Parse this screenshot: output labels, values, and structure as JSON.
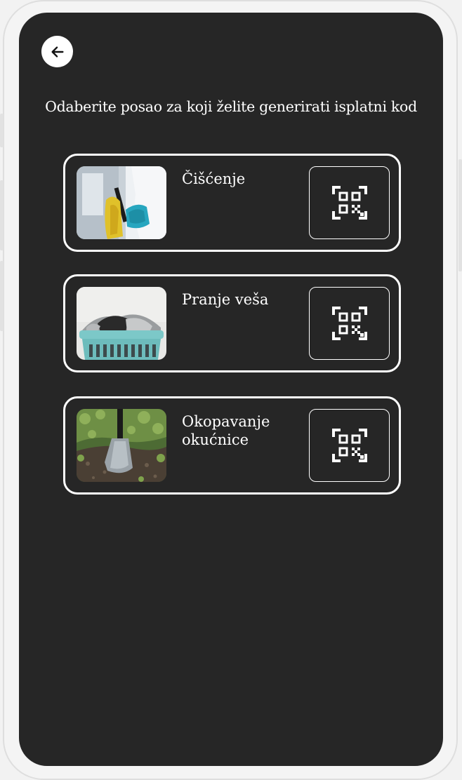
{
  "header": {
    "back_icon": "arrow-left-icon",
    "title": "Odaberite posao za koji želite generirati isplatni kod"
  },
  "jobs": [
    {
      "label": "Čišćenje",
      "image": "cleaning-photo",
      "action_icon": "qr-code-icon"
    },
    {
      "label": "Pranje veša",
      "image": "laundry-basket-photo",
      "action_icon": "qr-code-icon"
    },
    {
      "label": "Okopavanje okućnice",
      "image": "shovel-garden-photo",
      "action_icon": "qr-code-icon"
    }
  ],
  "colors": {
    "screen_background": "#262626",
    "card_border": "#ffffff",
    "text": "#ffffff"
  }
}
